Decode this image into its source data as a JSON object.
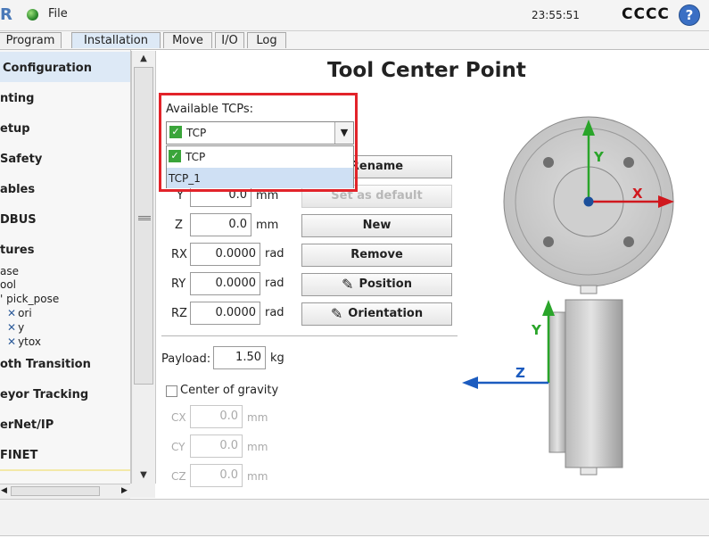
{
  "topbar": {
    "logo": "R",
    "file_menu": "File",
    "time": "23:55:51",
    "robot_name": "CCCC",
    "help": "?"
  },
  "tabs": [
    "Program",
    "Installation",
    "Move",
    "I/O",
    "Log"
  ],
  "sidebar": {
    "items": [
      {
        "label": "Configuration",
        "selected": true
      },
      {
        "label": "nting"
      },
      {
        "label": "etup"
      },
      {
        "label": "Safety"
      },
      {
        "label": "ables"
      },
      {
        "label": "DBUS"
      },
      {
        "label": "tures"
      }
    ],
    "features": [
      {
        "label": "ase"
      },
      {
        "label": "ool"
      },
      {
        "label": "' pick_pose"
      }
    ],
    "pick_pose_children": [
      "ori",
      "y",
      "ytox"
    ],
    "items_bottom": [
      {
        "label": "oth Transition"
      },
      {
        "label": "eyor Tracking"
      },
      {
        "label": "erNet/IP"
      },
      {
        "label": "FINET"
      }
    ]
  },
  "main": {
    "title": "Tool Center Point",
    "available_label": "Available TCPs:",
    "combo_value": "TCP",
    "dropdown_options": [
      {
        "label": "TCP",
        "default": true
      },
      {
        "label": "TCP_1",
        "highlighted": true
      }
    ],
    "coords": [
      {
        "axis": "Y",
        "value": "0.0",
        "unit": "mm"
      },
      {
        "axis": "Z",
        "value": "0.0",
        "unit": "mm"
      },
      {
        "axis": "RX",
        "value": "0.0000",
        "unit": "rad"
      },
      {
        "axis": "RY",
        "value": "0.0000",
        "unit": "rad"
      },
      {
        "axis": "RZ",
        "value": "0.0000",
        "unit": "rad"
      }
    ],
    "buttons": {
      "rename": "Rename",
      "set_default": "Set as default",
      "new": "New",
      "remove": "Remove",
      "position": "Position",
      "orientation": "Orientation"
    },
    "payload_label": "Payload:",
    "payload_value": "1.50",
    "payload_unit": "kg",
    "cog_label": "Center of gravity",
    "cog": [
      {
        "axis": "CX",
        "value": "0.0",
        "unit": "mm"
      },
      {
        "axis": "CY",
        "value": "0.0",
        "unit": "mm"
      },
      {
        "axis": "CZ",
        "value": "0.0",
        "unit": "mm"
      }
    ]
  },
  "diagram": {
    "top_axes": {
      "y": "Y",
      "x": "X"
    },
    "side_axes": {
      "y": "Y",
      "z": "Z"
    },
    "colors": {
      "x_axis": "#d0181e",
      "y_axis": "#2aa52a",
      "z_axis": "#1b5bbf",
      "accent_red": "#e2232a"
    }
  }
}
